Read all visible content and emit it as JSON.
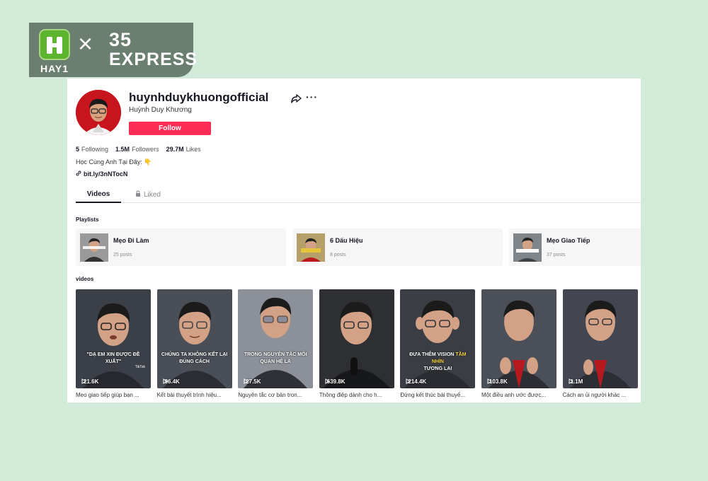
{
  "brand": {
    "logo_letter": "H",
    "name": "HAY1",
    "separator": "×",
    "partner_line1": "35",
    "partner_line2": "EXPRESS"
  },
  "profile": {
    "username": "huynhduykhuongofficial",
    "display_name": "Huỳnh Duy Khương",
    "follow_label": "Follow",
    "stats": [
      {
        "value": "5",
        "label": "Following"
      },
      {
        "value": "1.5M",
        "label": "Followers"
      },
      {
        "value": "29.7M",
        "label": "Likes"
      }
    ],
    "bio": "Học Cùng Anh Tại Đây: 👇",
    "link": "bit.ly/3nNTocN"
  },
  "tabs": [
    {
      "label": "Videos",
      "active": true
    },
    {
      "label": "Liked",
      "active": false
    }
  ],
  "playlists_title": "Playlists",
  "playlists": [
    {
      "name": "Mẹo Đi Làm",
      "count": "25 posts"
    },
    {
      "name": "6 Dấu Hiệu",
      "count": "8 posts"
    },
    {
      "name": "Mẹo Giao Tiếp",
      "count": "37 posts"
    }
  ],
  "videos_title": "videos",
  "videos": [
    {
      "caption": "\"DẠ EM XIN ĐƯỢC ĐỀ XUẤT\"",
      "views": "21.6K",
      "desc": "Mẹo giao tiếp giúp bạn ...",
      "bg": "#3b3f47",
      "mark": "TikTok"
    },
    {
      "caption": "CHÚNG TA KHÔNG KẾT LẠI ĐÚNG CÁCH",
      "views": "96.4K",
      "desc": "Kết bài thuyết trình hiệu...",
      "bg": "#4a4e57",
      "mark": ""
    },
    {
      "caption": "TRONG NGUYÊN TẮC MỐI QUAN HỆ LÀ",
      "views": "27.5K",
      "desc": "Nguyên tắc cơ bản tron...",
      "bg": "#8c9098",
      "mark": ""
    },
    {
      "caption": "",
      "views": "639.8K",
      "desc": "Thông điệp dành cho h...",
      "bg": "#2e2f33",
      "mark": ""
    },
    {
      "caption": "ĐƯA THÊM VISION",
      "caption_hl": "TẦM NHÌN",
      "caption_end": "TƯƠNG LAI",
      "views": "214.4K",
      "desc": "Đừng kết thúc bài thuyế...",
      "bg": "#3a3d44",
      "mark": ""
    },
    {
      "caption": "",
      "views": "103.8K",
      "desc": "Một điều anh ước được...",
      "bg": "#4b4f58",
      "mark": ""
    },
    {
      "caption": "",
      "views": "1.1M",
      "desc": "Cách an ủi người khác ...",
      "bg": "#434650",
      "mark": ""
    }
  ],
  "colors": {
    "background": "#d2ebd8",
    "follow": "#fe2c55",
    "brand_green": "#5cb42f",
    "caption_highlight": "#f7d23a"
  },
  "icons": [
    "share-icon",
    "more-icon",
    "link-icon",
    "lock-icon",
    "play-icon"
  ]
}
